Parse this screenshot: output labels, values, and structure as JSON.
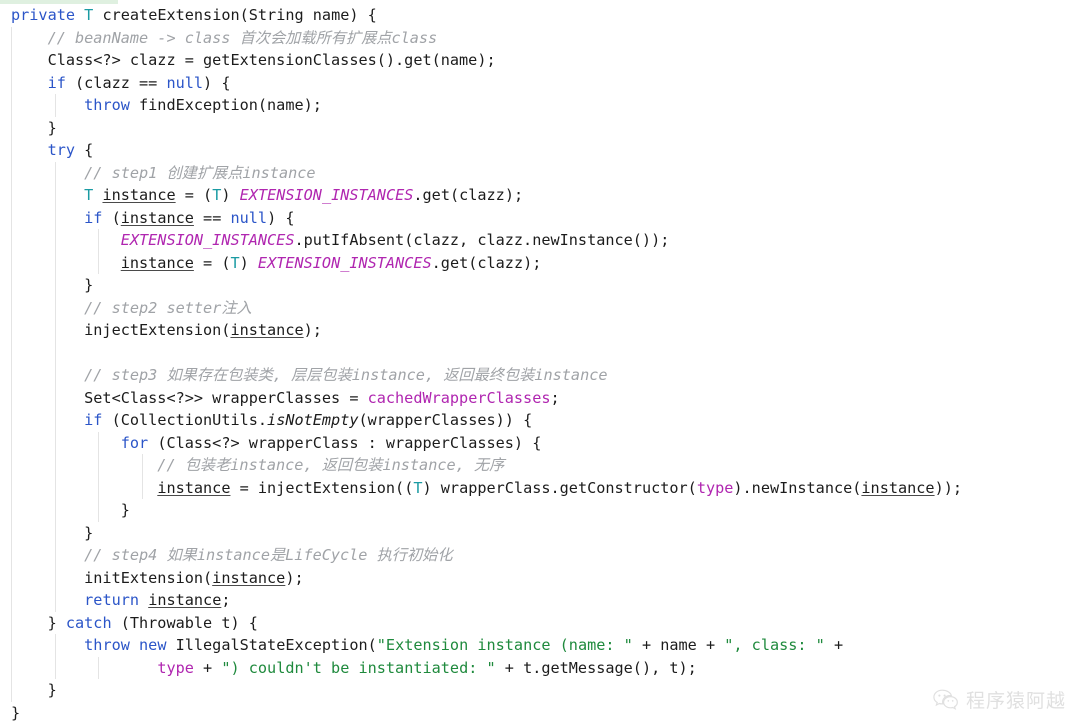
{
  "editor": {
    "language": "java",
    "theme_background": "#ffffff",
    "colors": {
      "keyword": "#2b55c8",
      "type": "#1a9ba3",
      "comment": "#a0a3a7",
      "field": "#b026b0",
      "string": "#1f8a3d",
      "plain": "#1c1c1c",
      "indent_guide": "#e4e4e4",
      "top_highlight": "#dff0e0"
    }
  },
  "code": {
    "lines": [
      {
        "indent": 0,
        "guides": [],
        "tokens": [
          {
            "t": "private",
            "c": "kw"
          },
          {
            "t": " ",
            "c": "pl"
          },
          {
            "t": "T",
            "c": "typ"
          },
          {
            "t": " createExtension(String name) {",
            "c": "pl"
          }
        ]
      },
      {
        "indent": 1,
        "guides": [
          "g0"
        ],
        "tokens": [
          {
            "t": "    // beanName -> class 首次会加载所有扩展点class",
            "c": "cm"
          }
        ]
      },
      {
        "indent": 1,
        "guides": [
          "g0"
        ],
        "tokens": [
          {
            "t": "    Class<?> clazz = getExtensionClasses().get(name);",
            "c": "pl"
          }
        ]
      },
      {
        "indent": 1,
        "guides": [
          "g0"
        ],
        "tokens": [
          {
            "t": "    ",
            "c": "pl"
          },
          {
            "t": "if",
            "c": "kw"
          },
          {
            "t": " (clazz == ",
            "c": "pl"
          },
          {
            "t": "null",
            "c": "kw"
          },
          {
            "t": ") {",
            "c": "pl"
          }
        ]
      },
      {
        "indent": 2,
        "guides": [
          "g0",
          "g1"
        ],
        "tokens": [
          {
            "t": "        ",
            "c": "pl"
          },
          {
            "t": "throw",
            "c": "kw"
          },
          {
            "t": " findException(name);",
            "c": "pl"
          }
        ]
      },
      {
        "indent": 1,
        "guides": [
          "g0"
        ],
        "tokens": [
          {
            "t": "    }",
            "c": "pl"
          }
        ]
      },
      {
        "indent": 1,
        "guides": [
          "g0"
        ],
        "tokens": [
          {
            "t": "    ",
            "c": "pl"
          },
          {
            "t": "try",
            "c": "kw"
          },
          {
            "t": " {",
            "c": "pl"
          }
        ]
      },
      {
        "indent": 2,
        "guides": [
          "g0",
          "g1"
        ],
        "tokens": [
          {
            "t": "        // step1 创建扩展点instance",
            "c": "cm"
          }
        ]
      },
      {
        "indent": 2,
        "guides": [
          "g0",
          "g1"
        ],
        "tokens": [
          {
            "t": "        ",
            "c": "pl"
          },
          {
            "t": "T",
            "c": "typ"
          },
          {
            "t": " ",
            "c": "pl"
          },
          {
            "t": "instance",
            "c": "lv"
          },
          {
            "t": " = (",
            "c": "pl"
          },
          {
            "t": "T",
            "c": "typ"
          },
          {
            "t": ") ",
            "c": "pl"
          },
          {
            "t": "EXTENSION_INSTANCES",
            "c": "fldi"
          },
          {
            "t": ".get(clazz);",
            "c": "pl"
          }
        ]
      },
      {
        "indent": 2,
        "guides": [
          "g0",
          "g1"
        ],
        "tokens": [
          {
            "t": "        ",
            "c": "pl"
          },
          {
            "t": "if",
            "c": "kw"
          },
          {
            "t": " (",
            "c": "pl"
          },
          {
            "t": "instance",
            "c": "lv"
          },
          {
            "t": " == ",
            "c": "pl"
          },
          {
            "t": "null",
            "c": "kw"
          },
          {
            "t": ") {",
            "c": "pl"
          }
        ]
      },
      {
        "indent": 3,
        "guides": [
          "g0",
          "g1",
          "g2"
        ],
        "tokens": [
          {
            "t": "            ",
            "c": "pl"
          },
          {
            "t": "EXTENSION_INSTANCES",
            "c": "fldi"
          },
          {
            "t": ".putIfAbsent(clazz, clazz.newInstance());",
            "c": "pl"
          }
        ]
      },
      {
        "indent": 3,
        "guides": [
          "g0",
          "g1",
          "g2"
        ],
        "tokens": [
          {
            "t": "            ",
            "c": "pl"
          },
          {
            "t": "instance",
            "c": "lv"
          },
          {
            "t": " = (",
            "c": "pl"
          },
          {
            "t": "T",
            "c": "typ"
          },
          {
            "t": ") ",
            "c": "pl"
          },
          {
            "t": "EXTENSION_INSTANCES",
            "c": "fldi"
          },
          {
            "t": ".get(clazz);",
            "c": "pl"
          }
        ]
      },
      {
        "indent": 2,
        "guides": [
          "g0",
          "g1"
        ],
        "tokens": [
          {
            "t": "        }",
            "c": "pl"
          }
        ]
      },
      {
        "indent": 2,
        "guides": [
          "g0",
          "g1"
        ],
        "tokens": [
          {
            "t": "        // step2 setter注入",
            "c": "cm"
          }
        ]
      },
      {
        "indent": 2,
        "guides": [
          "g0",
          "g1"
        ],
        "tokens": [
          {
            "t": "        injectExtension(",
            "c": "pl"
          },
          {
            "t": "instance",
            "c": "lv"
          },
          {
            "t": ");",
            "c": "pl"
          }
        ]
      },
      {
        "indent": 2,
        "guides": [
          "g0",
          "g1"
        ],
        "tokens": []
      },
      {
        "indent": 2,
        "guides": [
          "g0",
          "g1"
        ],
        "tokens": [
          {
            "t": "        // step3 如果存在包装类, 层层包装instance, 返回最终包装instance",
            "c": "cm"
          }
        ]
      },
      {
        "indent": 2,
        "guides": [
          "g0",
          "g1"
        ],
        "tokens": [
          {
            "t": "        Set<Class<?>> wrapperClasses = ",
            "c": "pl"
          },
          {
            "t": "cachedWrapperClasses",
            "c": "fld"
          },
          {
            "t": ";",
            "c": "pl"
          }
        ]
      },
      {
        "indent": 2,
        "guides": [
          "g0",
          "g1"
        ],
        "tokens": [
          {
            "t": "        ",
            "c": "pl"
          },
          {
            "t": "if",
            "c": "kw"
          },
          {
            "t": " (CollectionUtils.",
            "c": "pl"
          },
          {
            "t": "isNotEmpty",
            "c": "mi"
          },
          {
            "t": "(wrapperClasses)) {",
            "c": "pl"
          }
        ]
      },
      {
        "indent": 3,
        "guides": [
          "g0",
          "g1",
          "g2"
        ],
        "tokens": [
          {
            "t": "            ",
            "c": "pl"
          },
          {
            "t": "for",
            "c": "kw"
          },
          {
            "t": " (Class<?> wrapperClass : wrapperClasses) {",
            "c": "pl"
          }
        ]
      },
      {
        "indent": 4,
        "guides": [
          "g0",
          "g1",
          "g2",
          "g3"
        ],
        "tokens": [
          {
            "t": "                // 包装老instance, 返回包装instance, 无序",
            "c": "cm"
          }
        ]
      },
      {
        "indent": 4,
        "guides": [
          "g0",
          "g1",
          "g2",
          "g3"
        ],
        "tokens": [
          {
            "t": "                ",
            "c": "pl"
          },
          {
            "t": "instance",
            "c": "lv"
          },
          {
            "t": " = injectExtension((",
            "c": "pl"
          },
          {
            "t": "T",
            "c": "typ"
          },
          {
            "t": ") wrapperClass.getConstructor(",
            "c": "pl"
          },
          {
            "t": "type",
            "c": "fld"
          },
          {
            "t": ").newInstance(",
            "c": "pl"
          },
          {
            "t": "instance",
            "c": "lv"
          },
          {
            "t": "));",
            "c": "pl"
          }
        ]
      },
      {
        "indent": 3,
        "guides": [
          "g0",
          "g1",
          "g2"
        ],
        "tokens": [
          {
            "t": "            }",
            "c": "pl"
          }
        ]
      },
      {
        "indent": 2,
        "guides": [
          "g0",
          "g1"
        ],
        "tokens": [
          {
            "t": "        }",
            "c": "pl"
          }
        ]
      },
      {
        "indent": 2,
        "guides": [
          "g0",
          "g1"
        ],
        "tokens": [
          {
            "t": "        // step4 如果instance是LifeCycle 执行初始化",
            "c": "cm"
          }
        ]
      },
      {
        "indent": 2,
        "guides": [
          "g0",
          "g1"
        ],
        "tokens": [
          {
            "t": "        initExtension(",
            "c": "pl"
          },
          {
            "t": "instance",
            "c": "lv"
          },
          {
            "t": ");",
            "c": "pl"
          }
        ]
      },
      {
        "indent": 2,
        "guides": [
          "g0",
          "g1"
        ],
        "tokens": [
          {
            "t": "        ",
            "c": "pl"
          },
          {
            "t": "return",
            "c": "kw"
          },
          {
            "t": " ",
            "c": "pl"
          },
          {
            "t": "instance",
            "c": "lv"
          },
          {
            "t": ";",
            "c": "pl"
          }
        ]
      },
      {
        "indent": 1,
        "guides": [
          "g0"
        ],
        "tokens": [
          {
            "t": "    } ",
            "c": "pl"
          },
          {
            "t": "catch",
            "c": "kw"
          },
          {
            "t": " (Throwable t) {",
            "c": "pl"
          }
        ]
      },
      {
        "indent": 2,
        "guides": [
          "g0",
          "g1"
        ],
        "tokens": [
          {
            "t": "        ",
            "c": "pl"
          },
          {
            "t": "throw",
            "c": "kw"
          },
          {
            "t": " ",
            "c": "pl"
          },
          {
            "t": "new",
            "c": "kw"
          },
          {
            "t": " IllegalStateException(",
            "c": "pl"
          },
          {
            "t": "\"Extension instance (name: \"",
            "c": "str"
          },
          {
            "t": " + name + ",
            "c": "pl"
          },
          {
            "t": "\", class: \"",
            "c": "str"
          },
          {
            "t": " +",
            "c": "pl"
          }
        ]
      },
      {
        "indent": 4,
        "guides": [
          "g0",
          "g1",
          "g2"
        ],
        "tokens": [
          {
            "t": "                ",
            "c": "pl"
          },
          {
            "t": "type",
            "c": "fld"
          },
          {
            "t": " + ",
            "c": "pl"
          },
          {
            "t": "\") couldn't be instantiated: \"",
            "c": "str"
          },
          {
            "t": " + t.getMessage(), t);",
            "c": "pl"
          }
        ]
      },
      {
        "indent": 1,
        "guides": [
          "g0"
        ],
        "tokens": [
          {
            "t": "    }",
            "c": "pl"
          }
        ]
      },
      {
        "indent": 0,
        "guides": [],
        "tokens": [
          {
            "t": "}",
            "c": "pl"
          }
        ]
      }
    ]
  },
  "watermark": {
    "icon": "wechat-icon",
    "text": "程序猿阿越"
  }
}
